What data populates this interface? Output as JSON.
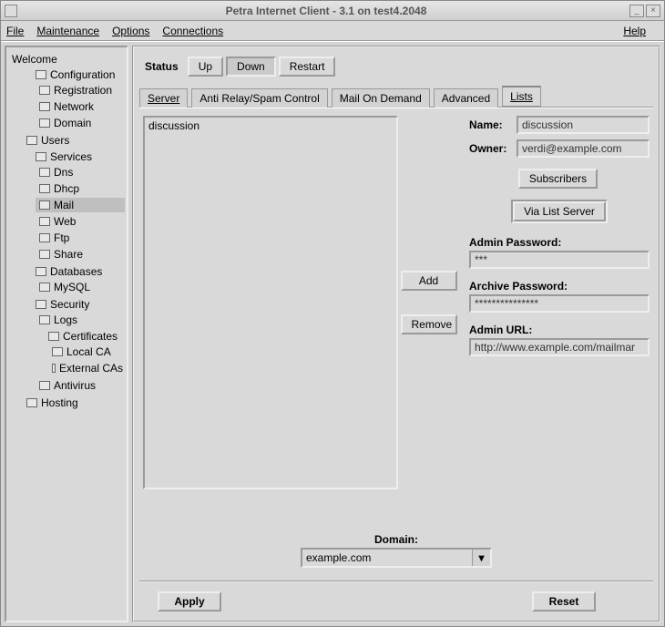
{
  "window": {
    "title": "Petra Internet Client - 3.1  on test4.2048"
  },
  "menubar": {
    "file": "File",
    "maintenance": "Maintenance",
    "options": "Options",
    "connections": "Connections",
    "help": "Help"
  },
  "sidebar": {
    "root": "Welcome",
    "items": [
      {
        "label": "Configuration",
        "children": [
          {
            "label": "Registration"
          },
          {
            "label": "Network"
          },
          {
            "label": "Domain"
          }
        ]
      },
      {
        "label": "Users"
      },
      {
        "label": "Services",
        "children": [
          {
            "label": "Dns"
          },
          {
            "label": "Dhcp"
          },
          {
            "label": "Mail",
            "selected": true
          },
          {
            "label": "Web"
          },
          {
            "label": "Ftp"
          },
          {
            "label": "Share"
          }
        ]
      },
      {
        "label": "Databases",
        "children": [
          {
            "label": "MySQL"
          }
        ]
      },
      {
        "label": "Security",
        "children": [
          {
            "label": "Logs"
          },
          {
            "label": "Certificates",
            "children": [
              {
                "label": "Local CA"
              },
              {
                "label": "External CAs"
              }
            ]
          },
          {
            "label": "Antivirus"
          }
        ]
      },
      {
        "label": "Hosting"
      }
    ]
  },
  "status": {
    "label": "Status",
    "up": "Up",
    "down": "Down",
    "restart": "Restart",
    "active": "Down"
  },
  "tabs": {
    "server": "Server",
    "antirelay": "Anti Relay/Spam Control",
    "mailondemand": "Mail On Demand",
    "advanced": "Advanced",
    "lists": "Lists",
    "active": "Lists"
  },
  "lists_panel": {
    "listbox_items": [
      "discussion"
    ],
    "add": "Add",
    "remove": "Remove",
    "name_label": "Name:",
    "name_value": "discussion",
    "owner_label": "Owner:",
    "owner_value": "verdi@example.com",
    "subscribers": "Subscribers",
    "via_list_server": "Via List Server",
    "admin_password_label": "Admin Password:",
    "admin_password_value": "***",
    "archive_password_label": "Archive Password:",
    "archive_password_value": "***************",
    "admin_url_label": "Admin URL:",
    "admin_url_value": "http://www.example.com/mailmar",
    "domain_label": "Domain:",
    "domain_value": "example.com"
  },
  "footer": {
    "apply": "Apply",
    "reset": "Reset"
  }
}
